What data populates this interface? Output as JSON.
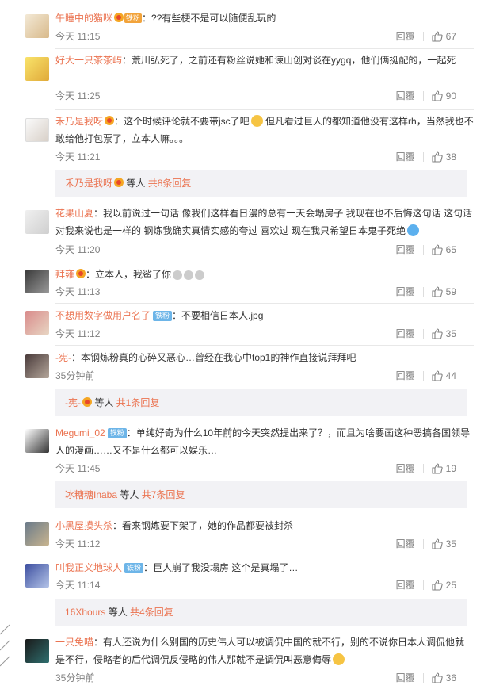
{
  "actions": {
    "reply_label": "回覆"
  },
  "comments": [
    {
      "user": "午睡中的猫咪",
      "badge": "铁粉",
      "text": "：??有些梗不是可以随便乱玩的",
      "time": "今天 11:15",
      "likes": "67"
    },
    {
      "user": "好大一只茶茶屿",
      "text": "：荒川弘死了，之前还有粉丝说她和谏山创对谈在yygq，他们俩挺配的，一起死",
      "time": "今天 11:25",
      "likes": "90"
    },
    {
      "user": "禾乃是我呀",
      "text": "：这个时候评论就不要带jsc了吧",
      "text2": "但凡看过巨人的都知道他没有这样rh，当然我也不敢给他打包票了，立本人嘛。。。",
      "time": "今天 11:21",
      "likes": "38"
    },
    {
      "user": "花果山夏",
      "text": "：我以前说过一句话 像我们这样看日漫的总有一天会塌房子 我现在也不后悔这句话 这句话对我来说也是一样的 钢炼我确实真情实感的夸过 喜欢过 现在我只希望日本鬼子死绝",
      "time": "今天 11:20",
      "likes": "65"
    },
    {
      "user": "拜雍",
      "text": "：立本人，我鲨了你",
      "time": "今天 11:13",
      "likes": "59"
    },
    {
      "user": "不想用数字做用户名了",
      "badge": "铁粉",
      "text": "：不要相信日本人.jpg",
      "time": "今天 11:12",
      "likes": "35"
    },
    {
      "user": "-宪-",
      "text": "：本钢炼粉真的心碎又恶心…曾经在我心中top1的神作直接说拜拜吧",
      "time": "35分钟前",
      "likes": "44"
    },
    {
      "user": "Megumi_02",
      "badge": "铁粉",
      "text": "：单纯好奇为什么10年前的今天突然提出来了？，而且为啥要画这种恶搞各国领导人的漫画……又不是什么都可以娱乐…",
      "time": "今天 11:45",
      "likes": "19"
    },
    {
      "user": "小黑屋摸头杀",
      "text": "：看来钢炼要下架了，她的作品都要被封杀",
      "time": "今天 11:12",
      "likes": "35"
    },
    {
      "user": "叫我正义地球人",
      "badge": "铁粉",
      "text": "：巨人崩了我没塌房 这个是真塌了…",
      "time": "今天 11:14",
      "likes": "25"
    },
    {
      "user": "一只免喵",
      "text": "：有人还说为什么别国的历史伟人可以被调侃中国的就不行，别的不说你日本人调侃他就是不行，侵略者的后代调侃反侵略的伟人那就不是调侃叫恶意侮辱",
      "time": "35分钟前",
      "likes": "36"
    }
  ],
  "threads": [
    {
      "name": "禾乃是我呀",
      "mid": " 等人 ",
      "count": "共8条回复"
    },
    {
      "name": "-宪-",
      "mid": " 等人 ",
      "count": "共1条回复"
    },
    {
      "name": "冰糖糖Inaba",
      "mid": " 等人 ",
      "count": "共7条回复"
    },
    {
      "name": "16Xhours",
      "mid": " 等人 ",
      "count": "共4条回复"
    }
  ]
}
